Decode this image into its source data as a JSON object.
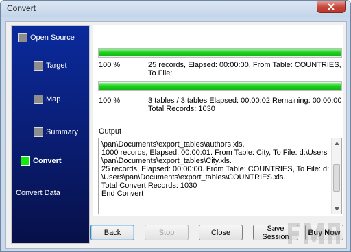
{
  "window": {
    "title": "Convert"
  },
  "sidebar": {
    "steps": [
      {
        "label": "Open Source",
        "active": false
      },
      {
        "label": "Target",
        "active": false
      },
      {
        "label": "Map",
        "active": false
      },
      {
        "label": "Summary",
        "active": false
      },
      {
        "label": "Convert",
        "active": true
      }
    ],
    "footer": "Convert Data"
  },
  "progress1": {
    "percent": 100,
    "percent_text": "100 %",
    "line1": "25 records,    Elapsed: 00:00:00.    From Table: COUNTRIES,",
    "line2": "To File:"
  },
  "progress2": {
    "percent": 100,
    "percent_text": "100 %",
    "line1": "3 tables / 3 tables    Elapsed: 00:00:02    Remaining: 00:00:00",
    "line2": "Total Records: 1030"
  },
  "output": {
    "label": "Output",
    "lines": [
      "\\pan\\Documents\\export_tables\\authors.xls.",
      "1000 records,    Elapsed: 00:00:01.    From Table: City,    To File: d:\\Users",
      "\\pan\\Documents\\export_tables\\City.xls.",
      "25 records,    Elapsed: 00:00:00.    From Table: COUNTRIES,    To File: d:",
      "\\Users\\pan\\Documents\\export_tables\\COUNTRIES.xls.",
      "Total Convert Records: 1030",
      "End Convert"
    ]
  },
  "buttons": {
    "back": "Back",
    "stop": "Stop",
    "close": "Close",
    "save_session": "Save Session",
    "buy_now": "Buy Now"
  },
  "colors": {
    "sidebar_top": "#0a2a9c",
    "sidebar_bottom": "#071048",
    "progress": "#1fd21f",
    "active_step": "#13ea13"
  }
}
